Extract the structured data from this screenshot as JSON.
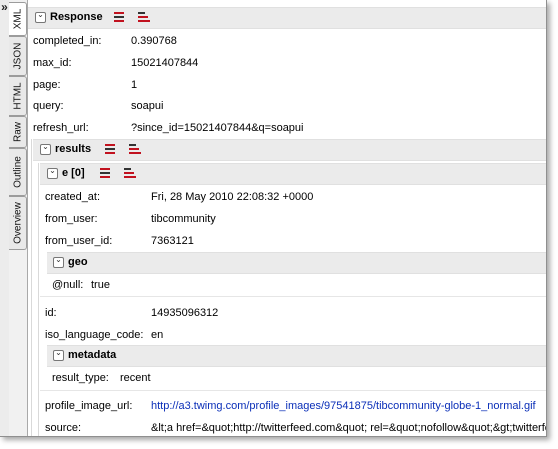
{
  "left_strip": {
    "glyph": "»"
  },
  "tabs": [
    {
      "label": "XML"
    },
    {
      "label": "JSON"
    },
    {
      "label": "HTML"
    },
    {
      "label": "Raw"
    },
    {
      "label": "Outline"
    },
    {
      "label": "Overview"
    }
  ],
  "response": {
    "title": "Response",
    "fields": [
      {
        "key": "completed_in:",
        "value": "0.390768"
      },
      {
        "key": "max_id:",
        "value": "15021407844"
      },
      {
        "key": "page:",
        "value": "1"
      },
      {
        "key": "query:",
        "value": "soapui"
      },
      {
        "key": "refresh_url:",
        "value": "?since_id=15021407844&q=soapui"
      }
    ]
  },
  "results": {
    "title": "results"
  },
  "entry": {
    "title": "e [0]",
    "fields_a": [
      {
        "key": "created_at:",
        "value": "Fri, 28 May 2010 22:08:32 +0000"
      },
      {
        "key": "from_user:",
        "value": "tibcommunity"
      },
      {
        "key": "from_user_id:",
        "value": "7363121"
      }
    ],
    "geo": {
      "title": "geo",
      "key": "@null:",
      "value": "true"
    },
    "fields_b": [
      {
        "key": "id:",
        "value": "14935096312"
      },
      {
        "key": "iso_language_code:",
        "value": "en"
      }
    ],
    "metadata": {
      "title": "metadata",
      "key": "result_type:",
      "value": "recent"
    },
    "fields_c": [
      {
        "key": "profile_image_url:",
        "value": "http://a3.twimg.com/profile_images/97541875/tibcommunity-globe-1_normal.gif"
      },
      {
        "key": "source:",
        "value": "&lt;a href=&quot;http://twitterfeed.com&quot; rel=&quot;nofollow&quot;&gt;twitterfeed&lt;/a&gt;"
      }
    ]
  }
}
